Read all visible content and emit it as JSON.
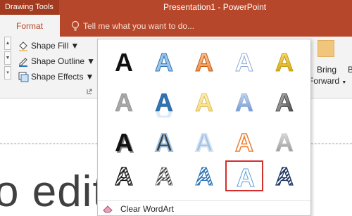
{
  "titlebar": {
    "context_label": "Drawing Tools",
    "app_title": "Presentation1 - PowerPoint",
    "accent": "#b7472a"
  },
  "tabs": {
    "format_label": "Format",
    "tell_me_placeholder": "Tell me what you want to do..."
  },
  "ribbon": {
    "shape_fill": "Shape Fill",
    "shape_outline": "Shape Outline",
    "shape_effects": "Shape Effects",
    "bring_forward_line1": "Bring",
    "bring_forward_line2": "Forward",
    "partial_right_label": "B"
  },
  "gallery": {
    "glyph": "A",
    "selected_row": 4,
    "selected_col": 4,
    "clear_label": "Clear WordArt",
    "styles": [
      [
        "black-fill",
        "blue-outline",
        "orange-gradient",
        "light-outline",
        "gold-gradient"
      ],
      [
        "gray-fill",
        "blue-reflection",
        "yellow-gradient",
        "blue-soft",
        "dark-bevel"
      ],
      [
        "black-shadow",
        "dark-glow",
        "blue-glow",
        "orange-outline",
        "gray-bevel"
      ],
      [
        "black-pattern",
        "gray-pattern",
        "blue-stripes",
        "blue-pattern-outline",
        "dark-blue-pattern"
      ]
    ],
    "selection_color": "#d32f2f"
  },
  "slide": {
    "text": "o edit title style"
  }
}
